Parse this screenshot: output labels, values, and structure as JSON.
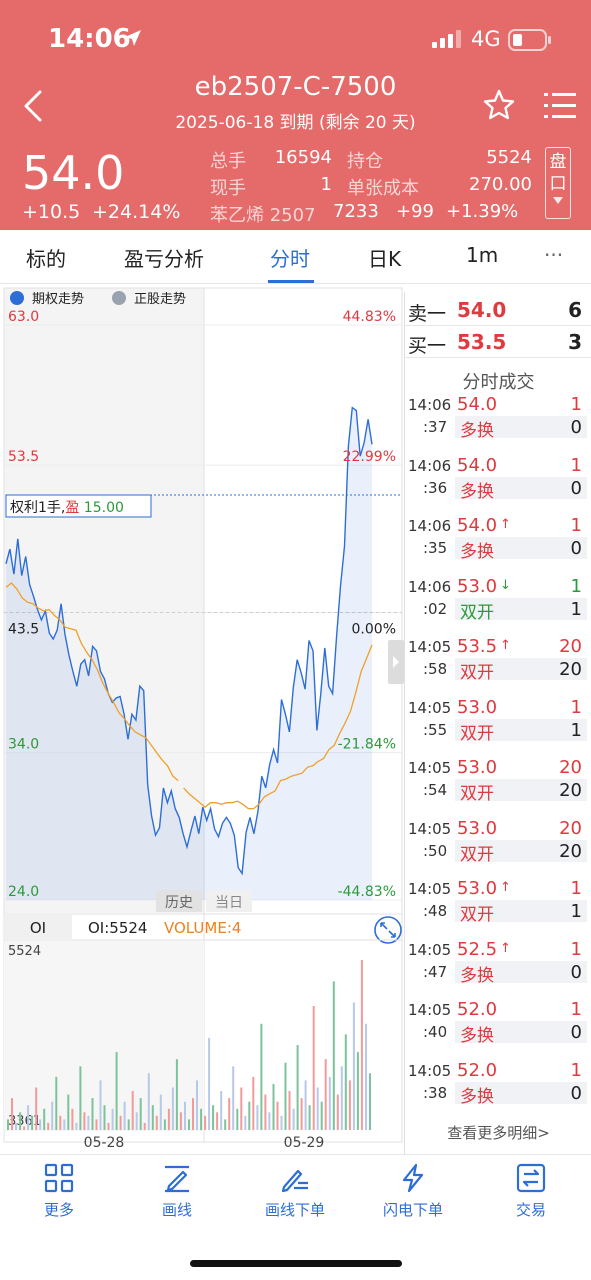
{
  "status_bar": {
    "time": "14:06",
    "network": "4G"
  },
  "header": {
    "title": "eb2507-C-7500",
    "expiry": "2025-06-18 到期 (剩余 20 天)",
    "last_price": "54.0",
    "change_abs": "+10.5",
    "change_pct": "+24.14%",
    "stats": {
      "total_volume_label": "总手",
      "total_volume": "16594",
      "open_interest_label": "持仓",
      "open_interest": "5524",
      "current_volume_label": "现手",
      "current_volume": "1",
      "unit_cost_label": "单张成本",
      "unit_cost": "270.00",
      "underlying_name": "苯乙烯 2507",
      "underlying_price": "7233",
      "underlying_change": "+99",
      "underlying_change_pct": "+1.39%"
    },
    "pan_button": "盘口"
  },
  "tabs": [
    {
      "label": "标的"
    },
    {
      "label": "盈亏分析"
    },
    {
      "label": "分时"
    },
    {
      "label": "日K"
    },
    {
      "label": "1m"
    },
    {
      "label": "···"
    }
  ],
  "chart_data": {
    "type": "line",
    "legend": [
      "期权走势",
      "正股走势"
    ],
    "ylim": [
      24.0,
      63.0
    ],
    "y_ticks_left": [
      "63.0",
      "53.5",
      "43.5",
      "34.0",
      "24.0"
    ],
    "y_ticks_right": [
      "44.83%",
      "22.99%",
      "0.00%",
      "-21.84%",
      "-44.83%"
    ],
    "x_labels": [
      "05-28",
      "05-29"
    ],
    "period_labels": [
      "历史",
      "当日"
    ],
    "position_label_prefix": "权利1手,",
    "position_label_pl_word": "盈",
    "position_label_pl": "15.00",
    "series": [
      {
        "name": "期权走势",
        "color": "#2d6ed6",
        "values": [
          46.8,
          47.8,
          46.1,
          48.5,
          46.0,
          47.3,
          45.4,
          44.6,
          43.7,
          43.0,
          43.6,
          42.1,
          41.7,
          42.3,
          44.1,
          42.0,
          40.6,
          39.5,
          38.5,
          40.0,
          40.3,
          39.2,
          41.2,
          40.9,
          39.5,
          39.0,
          38.0,
          37.4,
          37.7,
          37.8,
          36.6,
          34.9,
          36.6,
          36.2,
          38.5,
          38.2,
          31.8,
          29.7,
          28.4,
          28.9,
          31.6,
          30.6,
          31.4,
          30.2,
          29.6,
          28.5,
          27.6,
          28.7,
          29.7,
          28.5,
          30.3,
          29.4,
          30.2,
          28.8,
          28.3,
          29.2,
          29.6,
          29.2,
          28.4,
          26.2,
          25.8,
          28.6,
          29.6,
          28.5,
          30.0,
          32.4,
          31.6,
          33.2,
          34.2,
          33.3,
          37.6,
          36.6,
          35.4,
          38.4,
          40.3,
          39.4,
          38.3,
          41.6,
          40.9,
          35.5,
          38.0,
          41.1,
          38.5,
          38.0,
          41.9,
          45.3,
          48.0,
          54.8,
          57.4,
          57.2,
          54.1,
          55.0,
          56.6,
          54.9
        ]
      },
      {
        "name": "正股走势",
        "color": "#f0a02a",
        "values": [
          45.2,
          45.5,
          45.1,
          44.5,
          44.2,
          44.1,
          43.8,
          43.6,
          43.7,
          43.3,
          43.0,
          42.5,
          42.4,
          42.3,
          41.4,
          40.8,
          40.3,
          39.6,
          38.7,
          38.0,
          37.4,
          36.7,
          36.3,
          35.8,
          35.4,
          35.2,
          35.0,
          34.5,
          34.0,
          33.5,
          33.1,
          32.4,
          32.1,
          31.6,
          31.2,
          30.9,
          30.6,
          30.3,
          30.6,
          30.6,
          30.5,
          30.6,
          30.6,
          30.7,
          30.5,
          30.2,
          30.2,
          30.5,
          31.0,
          31.2,
          31.4,
          32.1,
          32.2,
          32.4,
          32.5,
          32.6,
          33.0,
          33.1,
          33.4,
          33.6,
          34.2,
          34.5,
          35.3,
          36.0,
          36.8,
          38.1,
          39.5,
          40.4,
          41.3
        ]
      }
    ],
    "oi_panel": {
      "tab_label": "OI",
      "oi_text": "OI:5524",
      "volume_text": "VOLUME:4",
      "y_top": "5524",
      "y_bottom": "3361",
      "volumes": [
        3,
        9,
        2,
        5,
        1,
        7,
        4,
        12,
        3,
        6,
        2,
        8,
        15,
        4,
        3,
        10,
        6,
        2,
        18,
        5,
        4,
        9,
        3,
        14,
        7,
        2,
        6,
        22,
        4,
        8,
        3,
        11,
        5,
        9,
        2,
        16,
        7,
        4,
        10,
        3,
        6,
        12,
        20,
        5,
        8,
        3,
        9,
        14,
        6,
        4,
        26,
        7,
        5,
        11,
        3,
        9,
        18,
        6,
        12,
        4,
        8,
        15,
        7,
        30,
        10,
        5,
        13,
        8,
        4,
        19,
        11,
        6,
        24,
        9,
        14,
        7,
        35,
        12,
        8,
        20,
        15,
        42,
        10,
        18,
        27,
        14,
        36,
        22,
        48,
        30,
        16
      ]
    }
  },
  "order_book": {
    "ask": {
      "label": "卖一",
      "price": "54.0",
      "volume": "6"
    },
    "bid": {
      "label": "买一",
      "price": "53.5",
      "volume": "3"
    }
  },
  "ticks_title": "分时成交",
  "ticks": [
    {
      "time": "14:06",
      "sec": ":37",
      "price": "54.0",
      "arrow": "",
      "vol": "1",
      "type": "多换",
      "oi": "0",
      "price_color": "#e0393e",
      "type_color": "#e0393e",
      "vol_color": "#e0393e"
    },
    {
      "time": "14:06",
      "sec": ":36",
      "price": "54.0",
      "arrow": "",
      "vol": "1",
      "type": "多换",
      "oi": "0",
      "price_color": "#e0393e",
      "type_color": "#e0393e",
      "vol_color": "#e0393e"
    },
    {
      "time": "14:06",
      "sec": ":35",
      "price": "54.0",
      "arrow": "↑",
      "vol": "1",
      "type": "多换",
      "oi": "0",
      "price_color": "#e0393e",
      "type_color": "#e0393e",
      "vol_color": "#e0393e"
    },
    {
      "time": "14:06",
      "sec": ":02",
      "price": "53.0",
      "arrow": "↓",
      "vol": "1",
      "type": "双开",
      "oi": "1",
      "price_color": "#e0393e",
      "type_color": "#2a9a3a",
      "vol_color": "#2a9a3a"
    },
    {
      "time": "14:05",
      "sec": ":58",
      "price": "53.5",
      "arrow": "↑",
      "vol": "20",
      "type": "双开",
      "oi": "20",
      "price_color": "#e0393e",
      "type_color": "#e0393e",
      "vol_color": "#e0393e"
    },
    {
      "time": "14:05",
      "sec": ":55",
      "price": "53.0",
      "arrow": "",
      "vol": "1",
      "type": "双开",
      "oi": "1",
      "price_color": "#e0393e",
      "type_color": "#e0393e",
      "vol_color": "#e0393e"
    },
    {
      "time": "14:05",
      "sec": ":54",
      "price": "53.0",
      "arrow": "",
      "vol": "20",
      "type": "双开",
      "oi": "20",
      "price_color": "#e0393e",
      "type_color": "#e0393e",
      "vol_color": "#e0393e"
    },
    {
      "time": "14:05",
      "sec": ":50",
      "price": "53.0",
      "arrow": "",
      "vol": "20",
      "type": "双开",
      "oi": "20",
      "price_color": "#e0393e",
      "type_color": "#e0393e",
      "vol_color": "#e0393e"
    },
    {
      "time": "14:05",
      "sec": ":48",
      "price": "53.0",
      "arrow": "↑",
      "vol": "1",
      "type": "双开",
      "oi": "1",
      "price_color": "#e0393e",
      "type_color": "#e0393e",
      "vol_color": "#e0393e"
    },
    {
      "time": "14:05",
      "sec": ":47",
      "price": "52.5",
      "arrow": "↑",
      "vol": "1",
      "type": "多换",
      "oi": "0",
      "price_color": "#e0393e",
      "type_color": "#e0393e",
      "vol_color": "#e0393e"
    },
    {
      "time": "14:05",
      "sec": ":40",
      "price": "52.0",
      "arrow": "",
      "vol": "1",
      "type": "多换",
      "oi": "0",
      "price_color": "#e0393e",
      "type_color": "#e0393e",
      "vol_color": "#e0393e"
    },
    {
      "time": "14:05",
      "sec": ":38",
      "price": "52.0",
      "arrow": "",
      "vol": "1",
      "type": "多换",
      "oi": "0",
      "price_color": "#e0393e",
      "type_color": "#e0393e",
      "vol_color": "#e0393e"
    }
  ],
  "more_detail": "查看更多明细>",
  "toolbar": [
    {
      "label": "更多",
      "icon": "grid-icon"
    },
    {
      "label": "画线",
      "icon": "draw-line-icon"
    },
    {
      "label": "画线下单",
      "icon": "draw-order-icon"
    },
    {
      "label": "闪电下单",
      "icon": "lightning-icon"
    },
    {
      "label": "交易",
      "icon": "trade-icon"
    }
  ],
  "colors": {
    "header_bg": "#e56a6a",
    "accent": "#2d6ed6",
    "up": "#e0393e",
    "down": "#2a9a3a",
    "underlying": "#f0a02a"
  }
}
